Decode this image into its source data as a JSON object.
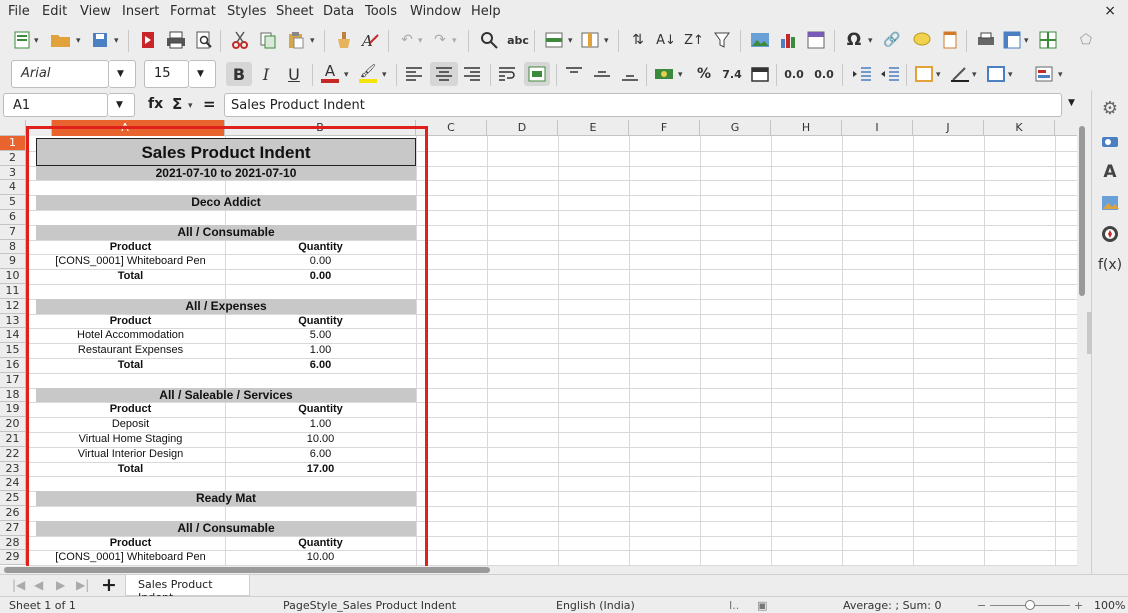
{
  "menubar": {
    "items": [
      "File",
      "Edit",
      "View",
      "Insert",
      "Format",
      "Styles",
      "Sheet",
      "Data",
      "Tools",
      "Window",
      "Help"
    ],
    "close": "×"
  },
  "toolbar2": {
    "font_name": "Arial",
    "font_size": "15"
  },
  "formula_bar": {
    "cell_ref": "A1",
    "fx": "fx",
    "sigma": "Σ",
    "equals": "=",
    "content": "Sales Product Indent"
  },
  "columns": [
    "A",
    "B",
    "C",
    "D",
    "E",
    "F",
    "G",
    "H",
    "I",
    "J",
    "K"
  ],
  "rows": [
    "1",
    "2",
    "3",
    "4",
    "5",
    "6",
    "7",
    "8",
    "9",
    "10",
    "11",
    "12",
    "13",
    "14",
    "15",
    "16",
    "17",
    "18",
    "19",
    "20",
    "21",
    "22",
    "23",
    "24",
    "25",
    "26",
    "27",
    "28",
    "29"
  ],
  "report": {
    "title": "Sales Product Indent",
    "date_range": "2021-07-10 to 2021-07-10",
    "cells": [
      {
        "row": 5,
        "a": "Deco Addict",
        "type": "group"
      },
      {
        "row": 7,
        "a": "All / Consumable",
        "type": "section"
      },
      {
        "row": 8,
        "a": "Product",
        "b": "Quantity",
        "type": "header"
      },
      {
        "row": 9,
        "a": "[CONS_0001] Whiteboard Pen",
        "b": "0.00",
        "type": "item"
      },
      {
        "row": 10,
        "a": "Total",
        "b": "0.00",
        "type": "total"
      },
      {
        "row": 12,
        "a": "All / Expenses",
        "type": "section"
      },
      {
        "row": 13,
        "a": "Product",
        "b": "Quantity",
        "type": "header"
      },
      {
        "row": 14,
        "a": "Hotel Accommodation",
        "b": "5.00",
        "type": "item"
      },
      {
        "row": 15,
        "a": "Restaurant Expenses",
        "b": "1.00",
        "type": "item"
      },
      {
        "row": 16,
        "a": "Total",
        "b": "6.00",
        "type": "total"
      },
      {
        "row": 18,
        "a": "All / Saleable / Services",
        "type": "section"
      },
      {
        "row": 19,
        "a": "Product",
        "b": "Quantity",
        "type": "header"
      },
      {
        "row": 20,
        "a": "Deposit",
        "b": "1.00",
        "type": "item"
      },
      {
        "row": 21,
        "a": "Virtual Home Staging",
        "b": "10.00",
        "type": "item"
      },
      {
        "row": 22,
        "a": "Virtual Interior Design",
        "b": "6.00",
        "type": "item"
      },
      {
        "row": 23,
        "a": "Total",
        "b": "17.00",
        "type": "total"
      },
      {
        "row": 25,
        "a": "Ready Mat",
        "type": "group"
      },
      {
        "row": 27,
        "a": "All / Consumable",
        "type": "section"
      },
      {
        "row": 28,
        "a": "Product",
        "b": "Quantity",
        "type": "header"
      },
      {
        "row": 29,
        "a": "[CONS_0001] Whiteboard Pen",
        "b": "10.00",
        "type": "item"
      }
    ]
  },
  "tabbar": {
    "add": "+",
    "sheet_tab": "Sales Product Indent"
  },
  "statusbar": {
    "sheet": "Sheet 1 of 1",
    "page_style": "PageStyle_Sales Product Indent",
    "language": "English (India)",
    "summary": "Average: ; Sum: 0",
    "zoom": "100%",
    "zoom_minus": "−",
    "zoom_plus": "+"
  },
  "colors": {
    "highlight_border": "#e0201b",
    "section_fill": "#c8c8c8",
    "selected_col": "#e9632f"
  }
}
